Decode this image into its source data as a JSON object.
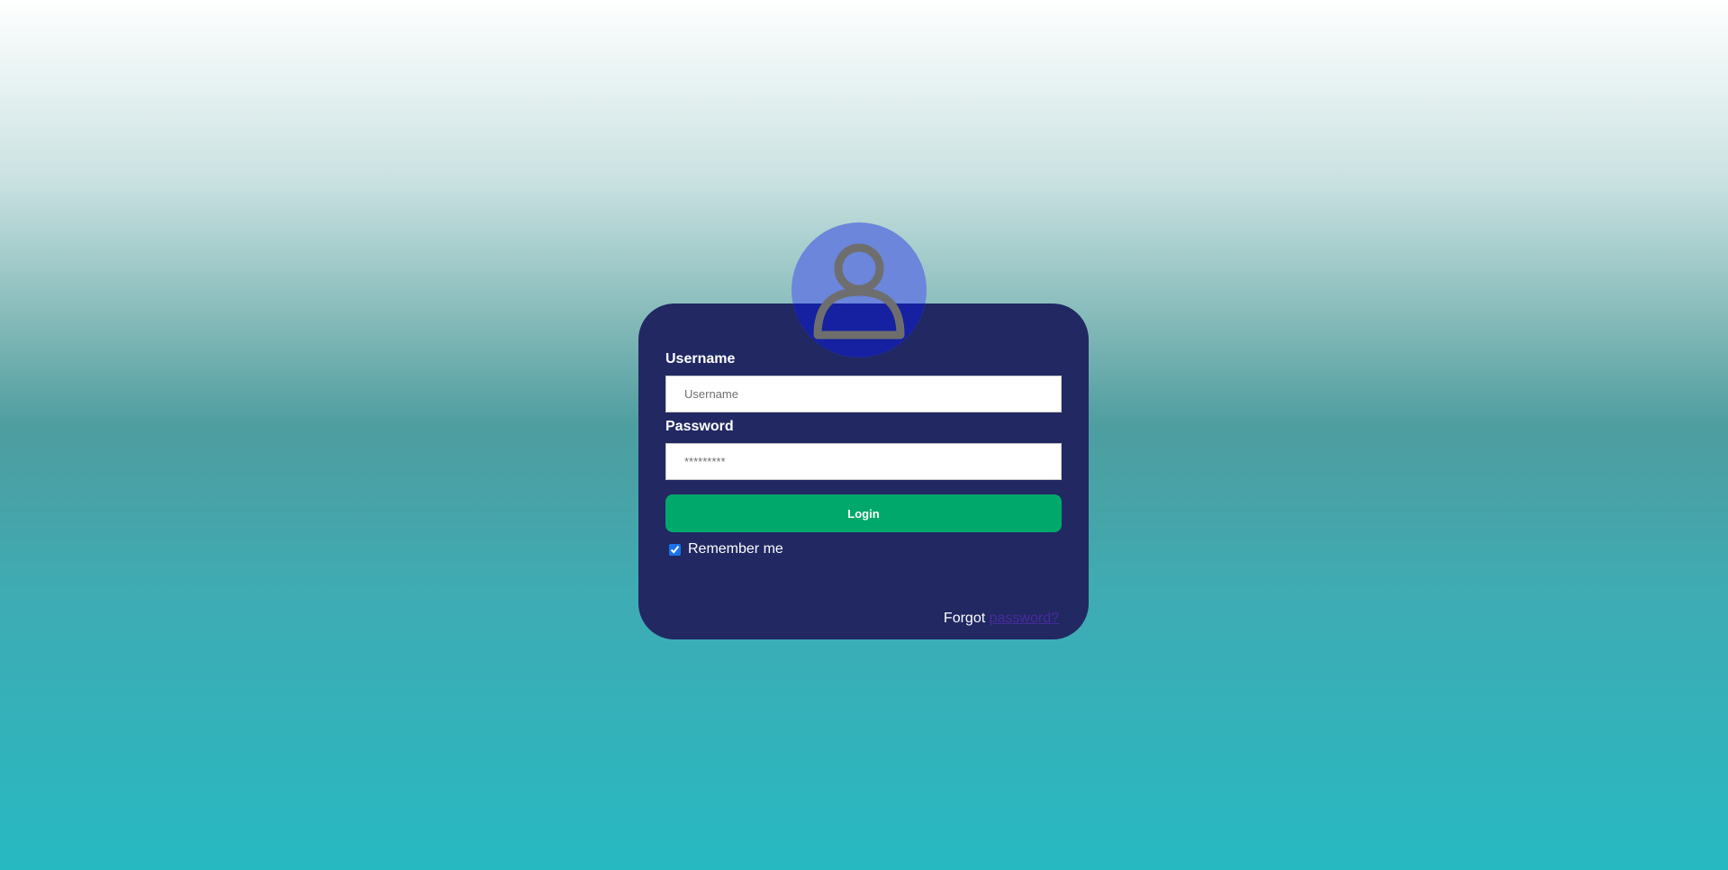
{
  "form": {
    "username_label": "Username",
    "username_placeholder": "Username",
    "username_value": "",
    "password_label": "Password",
    "password_placeholder": "*********",
    "password_value": "",
    "login_label": "Login",
    "remember_label": "Remember me",
    "remember_checked": true,
    "forgot_prefix": "Forgot",
    "forgot_link": "password?"
  },
  "icons": {
    "avatar": "user-icon"
  },
  "colors": {
    "card_background": "#212862",
    "login_button": "#00a86b",
    "avatar_top": "#6b86db",
    "avatar_bottom": "#1521a0",
    "forgot_link": "#4a2aa0"
  }
}
